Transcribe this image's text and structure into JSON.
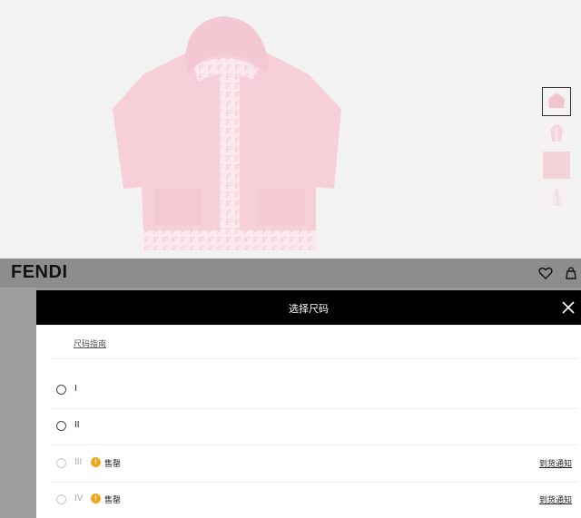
{
  "brand": {
    "logo": "FENDI"
  },
  "header": {
    "icons": [
      "heart-icon",
      "bag-icon"
    ]
  },
  "product": {
    "color": "#f6cfd8",
    "monogram_color": "#fbe5ea",
    "thumbnails": [
      "front-view",
      "detail-view",
      "fabric-view",
      "side-view"
    ]
  },
  "modal": {
    "title": "选择尺码",
    "size_guide": "尺码指南",
    "sizes": [
      {
        "label": "I",
        "status": "",
        "action": "",
        "available": true
      },
      {
        "label": "II",
        "status": "",
        "action": "",
        "available": true
      },
      {
        "label": "III",
        "status": "售罄",
        "action": "到货通知",
        "available": false
      },
      {
        "label": "IV",
        "status": "售罄",
        "action": "到货通知",
        "available": false
      }
    ]
  },
  "colors": {
    "header_bar": "#8d8d8d",
    "modal_head": "#000000",
    "warning": "#f0a818"
  }
}
